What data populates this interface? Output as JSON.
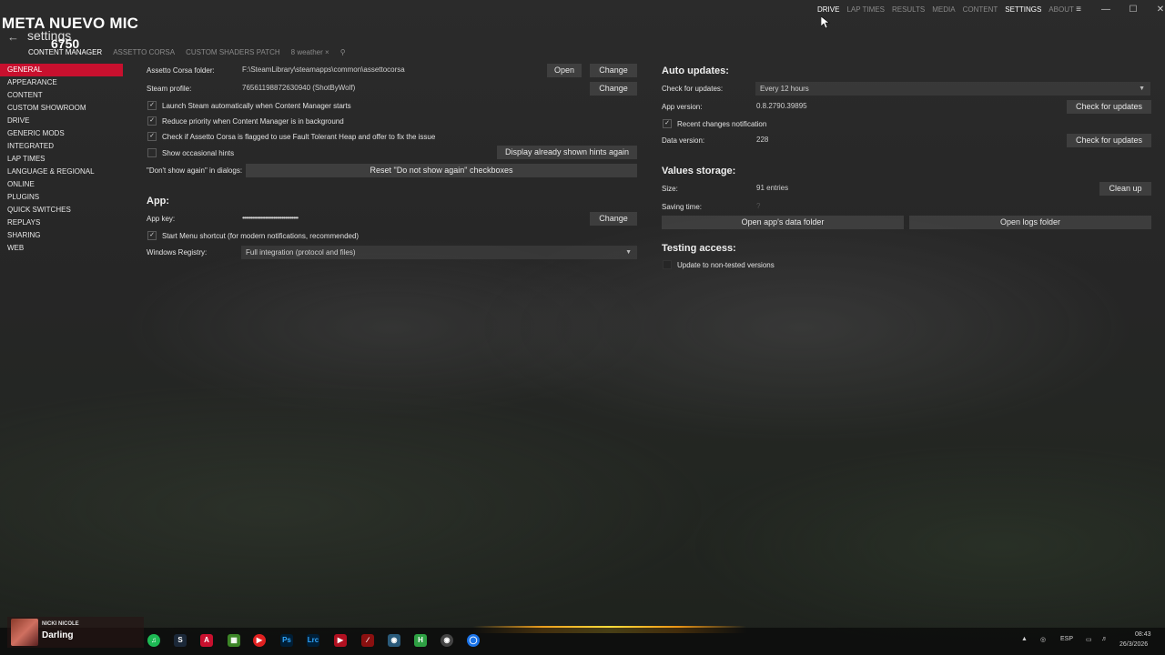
{
  "overlay": {
    "title": "META NUEVO MIC",
    "number": "6750"
  },
  "header": {
    "title": "settings",
    "tabs": [
      "CONTENT MANAGER",
      "ASSETTO CORSA",
      "CUSTOM SHADERS PATCH",
      "weather"
    ]
  },
  "top_nav": [
    "DRIVE",
    "LAP TIMES",
    "RESULTS",
    "MEDIA",
    "CONTENT",
    "SETTINGS",
    "ABOUT"
  ],
  "sidebar": {
    "items": [
      "GENERAL",
      "APPEARANCE",
      "CONTENT",
      "CUSTOM SHOWROOM",
      "DRIVE",
      "GENERIC MODS",
      "INTEGRATED",
      "LAP TIMES",
      "LANGUAGE & REGIONAL",
      "ONLINE",
      "PLUGINS",
      "QUICK SWITCHES",
      "REPLAYS",
      "SHARING",
      "WEB"
    ]
  },
  "general": {
    "ac_folder_label": "Assetto Corsa folder:",
    "ac_folder_value": "F:\\SteamLibrary\\steamapps\\common\\assettocorsa",
    "open_btn": "Open",
    "change_btn": "Change",
    "steam_label": "Steam profile:",
    "steam_value": "76561198872630940 (ShotByWolf)",
    "chk_launch": "Launch Steam automatically when Content Manager starts",
    "chk_priority": "Reduce priority when Content Manager is in background",
    "chk_fault": "Check if Assetto Corsa is flagged to use Fault Tolerant Heap and offer to fix the issue",
    "chk_hints": "Show occasional hints",
    "display_hints_btn": "Display already shown hints again",
    "dont_show_label": "\"Don't show again\" in dialogs:",
    "reset_btn": "Reset \"Do not show again\" checkboxes",
    "app_section": "App:",
    "app_key_label": "App key:",
    "app_key_value": "••••••••••••••••••••••••••••••••••",
    "chk_startmenu": "Start Menu shortcut (for modern notifications, recommended)",
    "registry_label": "Windows Registry:",
    "registry_value": "Full integration (protocol and files)"
  },
  "updates": {
    "section": "Auto updates:",
    "check_label": "Check for updates:",
    "check_value": "Every 12 hours",
    "app_version_label": "App version:",
    "app_version_value": "0.8.2790.39895",
    "check_btn": "Check for updates",
    "chk_recent": "Recent changes notification",
    "data_version_label": "Data version:",
    "data_version_value": "228",
    "values_section": "Values storage:",
    "size_label": "Size:",
    "size_value": "91 entries",
    "clean_btn": "Clean up",
    "saving_label": "Saving time:",
    "saving_value": "?",
    "open_data_btn": "Open app's data folder",
    "open_logs_btn": "Open logs folder",
    "testing_section": "Testing access:",
    "chk_nontested": "Update to non-tested versions"
  },
  "taskbar": {
    "now_playing_artist": "NICKI NICOLE",
    "now_playing_song": "Darling",
    "lang": "ESP",
    "time": "08:43",
    "date": "26/3/2026"
  },
  "colors": {
    "accent": "#c8102e"
  }
}
